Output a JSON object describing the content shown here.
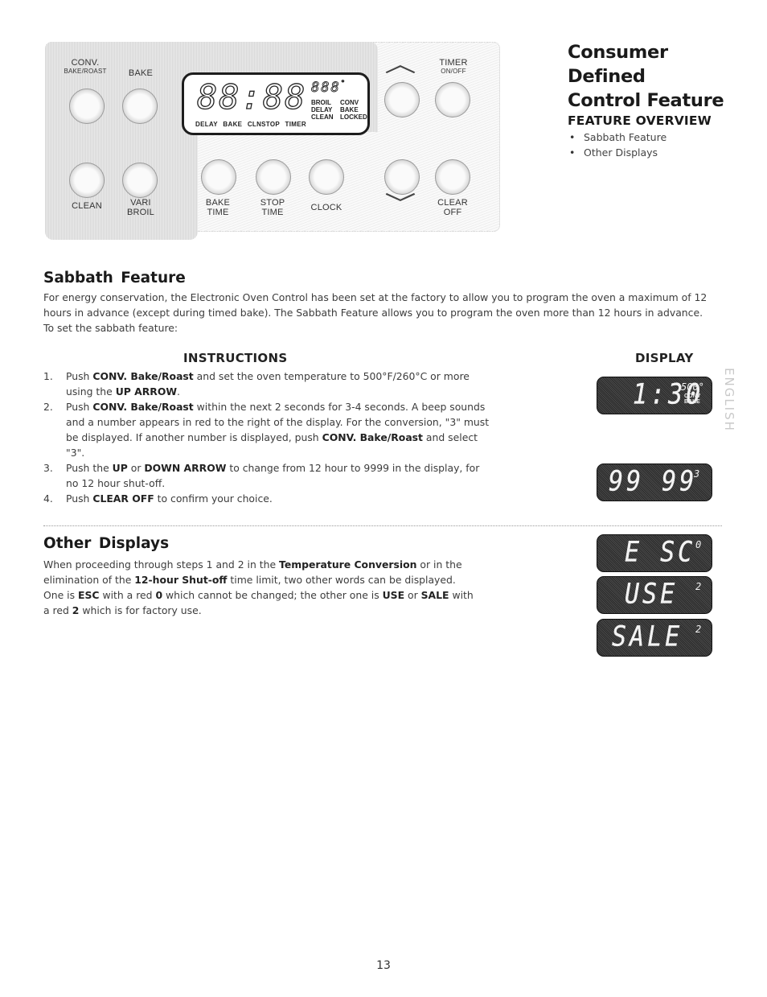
{
  "header": {
    "title_lines": [
      "Consumer",
      "Defined",
      "Control Feature"
    ],
    "subtitle": "FEATURE OVERVIEW",
    "overview_items": [
      "Sabbath Feature",
      "Other Displays"
    ]
  },
  "control_panel": {
    "buttons": {
      "conv_bake_roast": {
        "line1": "Conv.",
        "line2": "Bake/Roast"
      },
      "bake": "Bake",
      "clean": "Clean",
      "vari_broil": {
        "line1": "Vari",
        "line2": "Broil"
      },
      "bake_time": {
        "line1": "Bake",
        "line2": "Time"
      },
      "stop_time": {
        "line1": "Stop",
        "line2": "Time"
      },
      "clock": "Clock",
      "up_arrow": "up-arrow",
      "down_arrow": "down-arrow",
      "timer_on_off": {
        "line1": "Timer",
        "line2": "On/Off"
      },
      "clear_off": {
        "line1": "Clear",
        "line2": "Off"
      }
    },
    "lcd": {
      "digits": "88:88",
      "small_digits": "888",
      "degree": "°",
      "words_right": [
        "BROIL",
        "CONV",
        "DELAY",
        "BAKE",
        "CLEAN",
        "LOCKED"
      ],
      "words_bottom": [
        "DELAY",
        "BAKE",
        "CLNSTOP",
        "TIMER"
      ]
    }
  },
  "sabbath": {
    "heading": "Sabbath Feature",
    "intro": "For energy conservation, the Electronic Oven Control has been set at the factory to allow you to program the oven a maximum of 12 hours in advance (except during timed bake). The Sabbath Feature allows you to program the oven more than 12 hours in advance. To set the sabbath feature:",
    "instructions_heading": "INSTRUCTIONS",
    "display_heading": "DISPLAY",
    "steps": [
      {
        "num": "1.",
        "parts": [
          {
            "t": "Push "
          },
          {
            "b": "CONV. Bake/Roast"
          },
          {
            "t": " and set the oven temperature to 500°F/260°C or more using the "
          },
          {
            "b": "UP ARROW"
          },
          {
            "t": "."
          }
        ]
      },
      {
        "num": "2.",
        "parts": [
          {
            "t": "Push "
          },
          {
            "b": "CONV. Bake/Roast"
          },
          {
            "t": " within the next 2 seconds for 3-4 seconds.  A beep sounds and a number appears in red to the right of the display.  For the conversion, \"3\" must be displayed.  If another number is displayed, push "
          },
          {
            "b": "CONV. Bake/Roast"
          },
          {
            "t": " and select \"3\"."
          }
        ]
      },
      {
        "num": "3.",
        "parts": [
          {
            "t": "Push the "
          },
          {
            "b": "UP"
          },
          {
            "t": " or "
          },
          {
            "b": "DOWN ARROW"
          },
          {
            "t": " to change from 12 hour to 9999 in the display, for no 12 hour shut-off."
          }
        ]
      },
      {
        "num": "4.",
        "parts": [
          {
            "t": "Push "
          },
          {
            "b": "CLEAR OFF"
          },
          {
            "t": " to confirm your choice."
          }
        ]
      }
    ],
    "displays": [
      {
        "main": "1:30",
        "sup": "500°",
        "words": [
          "CONV",
          "BAKE"
        ]
      },
      {
        "main": "99 99",
        "sup": "3"
      }
    ]
  },
  "other_displays": {
    "heading": "Other Displays",
    "body": [
      {
        "t": "When proceeding through steps 1 and 2 in the "
      },
      {
        "b": "Temperature Conversion"
      },
      {
        "t": " or in the elimination of the "
      },
      {
        "b": "12-hour Shut-off"
      },
      {
        "t": " time limit, two other words can be displayed. One is "
      },
      {
        "b": "ESC"
      },
      {
        "t": " with a red "
      },
      {
        "b": "0"
      },
      {
        "t": " which cannot be changed; the other one is "
      },
      {
        "b": "USE"
      },
      {
        "t": " or "
      },
      {
        "b": "SALE"
      },
      {
        "t": " with a red "
      },
      {
        "b": "2"
      },
      {
        "t": " which is for factory use."
      }
    ],
    "displays": [
      {
        "main": "E SC",
        "sup": "0"
      },
      {
        "main": "USE",
        "sup": "2"
      },
      {
        "main": "SALE",
        "sup": "2"
      }
    ]
  },
  "side_tab": "ENGLISH",
  "page_number": "13"
}
